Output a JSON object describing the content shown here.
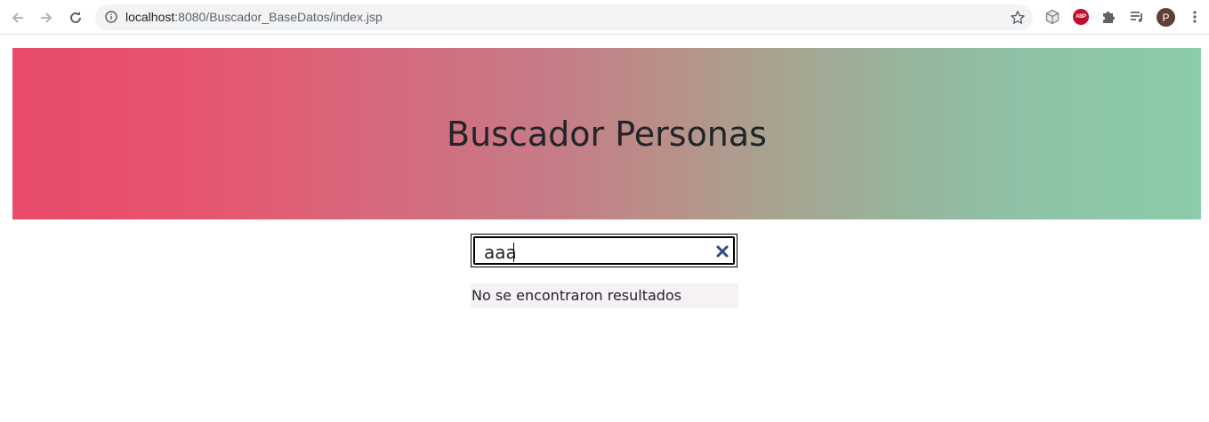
{
  "browser": {
    "url_host": "localhost",
    "url_rest": ":8080/Buscador_BaseDatos/index.jsp",
    "avatar_letter": "P",
    "abp_label": "ABP"
  },
  "header": {
    "title": "Buscador Personas"
  },
  "search": {
    "value": "aaa"
  },
  "results": {
    "message": "No se encontraron resultados"
  }
}
